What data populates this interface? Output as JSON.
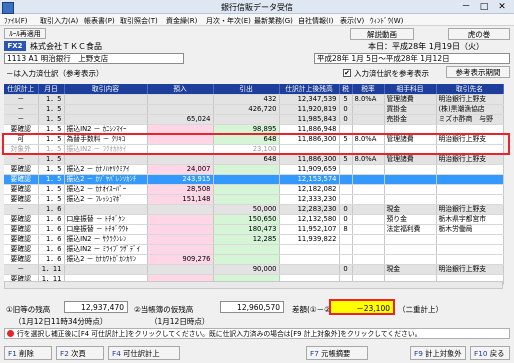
{
  "window": {
    "title": "銀行信販データ受信",
    "min": "－",
    "max": "□",
    "close": "✕"
  },
  "menu": [
    "ﾌｧｲﾙ(F)",
    "取引入力(A)",
    "帳表書(P)",
    "取引照会(T)",
    "資金繰(R)",
    "月次・年次(E)",
    "最新業務(G)",
    "自社情報(I)",
    "表示(V)",
    "ｳｨﾝﾄﾞｳ(W)"
  ],
  "toolbar": {
    "rule_button": "ﾙｰﾙ再適用",
    "explain_button": "解説動画",
    "back_button": "虎の巻"
  },
  "company": {
    "badge": "FX2",
    "name": "株式会社ＴＫＣ食品",
    "today": "本日：平成28年 1月19日（火）"
  },
  "account": {
    "bank": "1113 A1 明治銀行　上野支店",
    "period": "平成28年 1月 5日～平成28年 1月12日"
  },
  "note": "－は入力済仕訳（参考表示）",
  "ref_checkbox": {
    "label": "入力済仕訳を参考表示",
    "checked": "✔"
  },
  "ref_period_button": "参考表示期間",
  "columns": [
    "仕訳計上",
    "月日",
    "取引内容",
    "預入",
    "引出",
    "仕訳計上後残高",
    "税",
    "税率",
    "相手科目",
    "取引先名"
  ],
  "rows": [
    {
      "s": "－",
      "d": "1．5",
      "c": "",
      "dep": "",
      "wd": "432",
      "bal": "12,347,539",
      "tax": "5",
      "rate": "8.0%A",
      "acct": "管理諸費",
      "ptn": "明治銀行上野支",
      "style": "gray"
    },
    {
      "s": "－",
      "d": "1．5",
      "c": "",
      "dep": "",
      "wd": "426,720",
      "bal": "11,920,819",
      "tax": "0",
      "rate": "",
      "acct": "買掛金",
      "ptn": "(株)黒潮漁協店",
      "style": "gray"
    },
    {
      "s": "－",
      "d": "1．5",
      "c": "",
      "dep": "65,024",
      "wd": "",
      "bal": "11,985,843",
      "tax": "0",
      "rate": "",
      "acct": "売掛金",
      "ptn": "ミズホ酢商　与野",
      "style": "gray"
    },
    {
      "s": "要確認",
      "d": "1．5",
      "c": "振込IN2 － ｶﾆｼﾝﾏｲｰ",
      "dep": "",
      "wd": "98,895",
      "bal": "11,886,948",
      "tax": "",
      "rate": "",
      "acct": "",
      "ptn": "",
      "style": "white"
    },
    {
      "s": "可",
      "d": "1．5",
      "c": "為替手数料 － ｸﾘｷｺ",
      "dep": "",
      "wd": "648",
      "bal": "11,886,300",
      "tax": "5",
      "rate": "8.0%A",
      "acct": "管理諸費",
      "ptn": "明治銀行上野支",
      "style": "white"
    },
    {
      "s": "対象外",
      "d": "1．5",
      "c": "振込IN2 － ﾌｸｵｶﾎｹｲ",
      "dep": "",
      "wd": "23,100",
      "bal": "",
      "tax": "",
      "rate": "",
      "acct": "",
      "ptn": "",
      "style": "grayed"
    },
    {
      "s": "－",
      "d": "1．5",
      "c": "",
      "dep": "",
      "wd": "648",
      "bal": "11,886,300",
      "tax": "5",
      "rate": "8.0%A",
      "acct": "管理諸費",
      "ptn": "明治銀行上野支",
      "style": "gray"
    },
    {
      "s": "要確認",
      "d": "1．5",
      "c": "振込2 － ｶﾅﾉﾊﾔﾘｸﾐｱｲ",
      "dep": "24,007",
      "wd": "",
      "bal": "11,909,659",
      "tax": "",
      "rate": "",
      "acct": "",
      "ptn": "",
      "style": "white"
    },
    {
      "s": "要確認",
      "d": "1．5",
      "c": "振込2 － ｶｿﾞﾔﾊﾟﾚﾝｿｶﾝﾁ",
      "dep": "243,915",
      "wd": "",
      "bal": "12,153,574",
      "tax": "",
      "rate": "",
      "acct": "",
      "ptn": "",
      "style": "sel"
    },
    {
      "s": "要確認",
      "d": "1．5",
      "c": "振込2 － ｶﾅｵｲｽｰﾊﾟｰ",
      "dep": "28,508",
      "wd": "",
      "bal": "12,182,082",
      "tax": "",
      "rate": "",
      "acct": "",
      "ptn": "",
      "style": "white"
    },
    {
      "s": "要確認",
      "d": "1．5",
      "c": "振込2 － ﾌﾚｯｼｭﾏﾎﾞ",
      "dep": "151,148",
      "wd": "",
      "bal": "12,333,230",
      "tax": "",
      "rate": "",
      "acct": "",
      "ptn": "",
      "style": "white"
    },
    {
      "s": "－",
      "d": "1．6",
      "c": "",
      "dep": "",
      "wd": "50,000",
      "bal": "12,283,230",
      "tax": "0",
      "rate": "",
      "acct": "現金",
      "ptn": "明治銀行上野支",
      "style": "gray"
    },
    {
      "s": "要確認",
      "d": "1．6",
      "c": "口座振替 － ﾄﾁｷﾞｹﾝ",
      "dep": "",
      "wd": "150,650",
      "bal": "12,132,580",
      "tax": "0",
      "rate": "",
      "acct": "預り金",
      "ptn": "栃木県宇都宮市",
      "style": "white"
    },
    {
      "s": "要確認",
      "d": "1．6",
      "c": "口座振替 － ﾄﾁｷﾞｳｳﾄ",
      "dep": "",
      "wd": "180,473",
      "bal": "11,952,107",
      "tax": "8",
      "rate": "",
      "acct": "法定福利費",
      "ptn": "栃木労働局",
      "style": "white"
    },
    {
      "s": "要確認",
      "d": "1．6",
      "c": "振込IN2 － ｻｸﾗｸﾝﾚﾝ",
      "dep": "",
      "wd": "12,285",
      "bal": "11,939,822",
      "tax": "",
      "rate": "",
      "acct": "",
      "ptn": "",
      "style": "white"
    },
    {
      "s": "要確認",
      "d": "1．6",
      "c": "振込IN2 － ﾐﾗｲﾌﾞﾗｻﾞﾃﾞｲ",
      "dep": "",
      "wd": "",
      "bal": "",
      "tax": "",
      "rate": "",
      "acct": "",
      "ptn": "",
      "style": "white"
    },
    {
      "s": "要確認",
      "d": "1．6",
      "c": "振込2 － ｶﾅｶﾜﾄｶﾞｶﾝｶﾘﾝ",
      "dep": "909,276",
      "wd": "",
      "bal": "",
      "tax": "",
      "rate": "",
      "acct": "",
      "ptn": "",
      "style": "white"
    },
    {
      "s": "－",
      "d": "1．11",
      "c": "",
      "dep": "",
      "wd": "90,000",
      "bal": "",
      "tax": "0",
      "rate": "",
      "acct": "現金",
      "ptn": "明治銀行上野支",
      "style": "gray"
    },
    {
      "s": "要確認",
      "d": "1．11",
      "c": "",
      "dep": "",
      "wd": "",
      "bal": "",
      "tax": "",
      "rate": "",
      "acct": "",
      "ptn": "",
      "style": "white"
    }
  ],
  "totals": {
    "prev_label": "①旧等の残高",
    "prev_value": "12,937,470",
    "prev_date": "（1月12日11時34分時点）",
    "current_label": "②当帳簿の仮残高",
    "current_value": "12,960,570",
    "current_date": "（1月12日時点）",
    "diff_label": "差額(①－②)",
    "diff_value": "－23,100",
    "diff_note": "（二重計上）"
  },
  "hint": "行を選択し補正後に[F4 可仕訳計上]をクリックしてください。既に仕訳入力済みの場合は[F9 計上対象外]をクリックしてください。",
  "fkeys": [
    {
      "key": "F1",
      "label": "削除"
    },
    {
      "key": "F2",
      "label": "次頁"
    },
    {
      "key": "F4",
      "label": "可仕訳計上"
    },
    {
      "key": "F7",
      "label": "元帳摘要"
    },
    {
      "key": "F9",
      "label": "計上対象外"
    },
    {
      "key": "F10",
      "label": "戻る"
    }
  ]
}
